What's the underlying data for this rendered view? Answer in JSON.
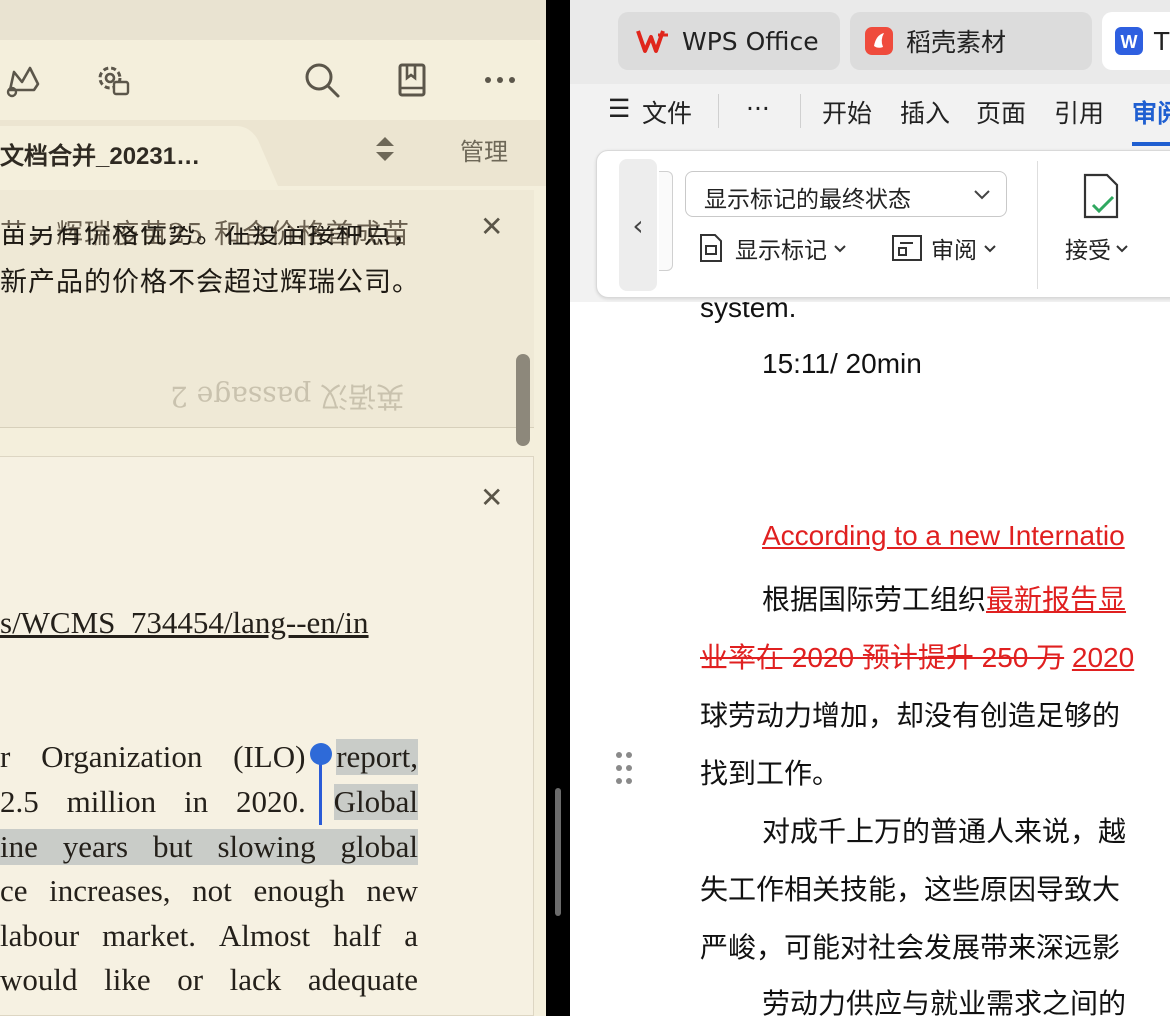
{
  "left_reader": {
    "tab_title": "文档合并_20231…",
    "manage_label": "管理",
    "scan_lines": [
      "苗另有价格优势。在疫苗接种点，",
      "新产品的价格不会超过辉瑞公司。"
    ],
    "scan_faded_text": "英语汉 passage 2",
    "link_line": "s/WCMS_734454/lang--en/in",
    "text_lines": [
      [
        "r",
        "Organization",
        "(ILO)",
        "report,"
      ],
      [
        "2.5",
        "million",
        "in",
        "2020.",
        "Global"
      ],
      [
        "ine",
        "years",
        "but",
        "slowing",
        "global"
      ],
      [
        "ce",
        "increases,",
        "not",
        "enough",
        "new"
      ],
      [
        "labour",
        "market.",
        "Almost",
        "half",
        "a"
      ],
      [
        "would",
        "like",
        "or",
        "lack",
        "adequate"
      ]
    ],
    "icons": [
      "crown-icon",
      "settings-gear-icon",
      "search-icon",
      "bookmark-icon",
      "more-icon"
    ]
  },
  "wps": {
    "tabs": [
      {
        "label": "WPS Office",
        "icon": "wps-logo-icon"
      },
      {
        "label": "稻壳素材",
        "icon": "docer-logo-icon"
      },
      {
        "label": "T",
        "icon": "word-doc-icon"
      }
    ],
    "menu": {
      "file": "文件",
      "more": "···",
      "items": [
        "开始",
        "插入",
        "页面",
        "引用"
      ],
      "active": "审阅"
    },
    "ribbon": {
      "markup_select": "显示标记的最终状态",
      "show_markup": "显示标记",
      "review": "审阅",
      "accept": "接受"
    },
    "document": {
      "line_system": "system.",
      "line_time": "15:11/ 20min",
      "line_en_red": "According to a new Internatio",
      "line_cn_1_plain": "根据国际劳工组织",
      "line_cn_1_ins": "最新报告显",
      "line_cn_2_del": "业率在 2020 预计提升 250 万",
      "line_cn_2_ins": "2020",
      "line_cn_3": "球劳动力增加，却没有创造足够的",
      "line_cn_4": "找到工作。",
      "line_cn_5": "对成千上万的普通人来说，越",
      "line_cn_6": "失工作相关技能，这些原因导致大",
      "line_cn_7": "严峻，可能对社会发展带来深远影",
      "line_cn_8": "劳动力供应与就业需求之间的"
    }
  }
}
